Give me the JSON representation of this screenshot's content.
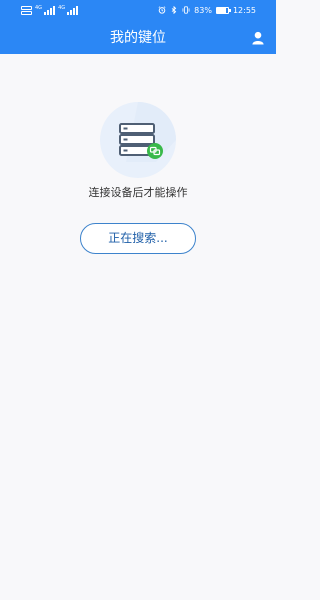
{
  "status_bar": {
    "network_left_tag": "4G",
    "network_right_tag": "4G",
    "battery_percent": "83%",
    "battery_level": 0.83,
    "time": "12:55",
    "icons": [
      "sim-icon",
      "signal-icon",
      "alarm-icon",
      "bluetooth-icon",
      "vibrate-icon",
      "battery-icon"
    ]
  },
  "header": {
    "title": "我的键位",
    "right_icon": "user-icon"
  },
  "main": {
    "illustration_icon": "server-icon",
    "badge_icon": "link-icon",
    "status_text": "连接设备后才能操作",
    "search_button_label": "正在搜索..."
  },
  "colors": {
    "header": "#2b87f5",
    "background": "#f8f8fa",
    "button_border": "#3d83cc",
    "badge": "#39b94a"
  }
}
